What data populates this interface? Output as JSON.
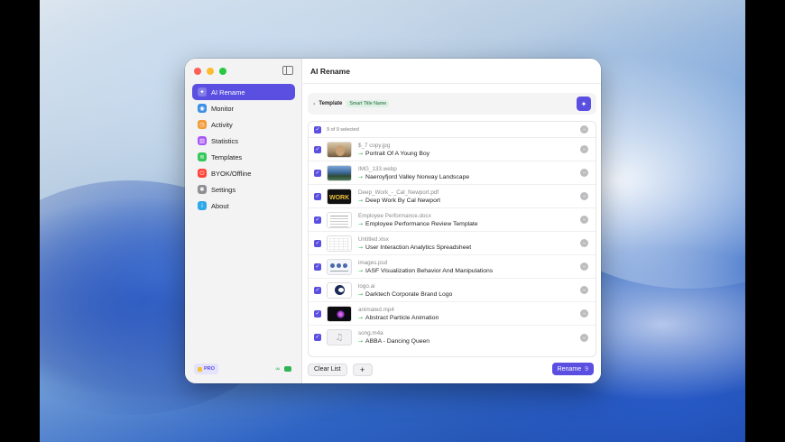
{
  "window": {
    "title": "AI Rename"
  },
  "sidebar": {
    "items": [
      {
        "label": "AI Rename",
        "icon": "sparkle-icon",
        "color": "#ffffff",
        "active": true
      },
      {
        "label": "Monitor",
        "icon": "eye-icon",
        "color": "#3a8ee6"
      },
      {
        "label": "Activity",
        "icon": "activity-icon",
        "color": "#f29b38"
      },
      {
        "label": "Statistics",
        "icon": "chart-icon",
        "color": "#a855f7"
      },
      {
        "label": "Templates",
        "icon": "layers-icon",
        "color": "#34c759"
      },
      {
        "label": "BYOK/Offline",
        "icon": "power-icon",
        "color": "#ff453a"
      },
      {
        "label": "Settings",
        "icon": "gear-icon",
        "color": "#8e8e93"
      },
      {
        "label": "About",
        "icon": "info-icon",
        "color": "#2ea8e6"
      }
    ],
    "badge": "PRO"
  },
  "template": {
    "label": "Template",
    "value": "Smart Title Name"
  },
  "list": {
    "header": "9 of 9 selected",
    "rows": [
      {
        "original": "$_7 copy.jpg",
        "renamed": "Portrait Of A Young Boy",
        "thumb": "portrait"
      },
      {
        "original": "IMG_133.webp",
        "renamed": "Naeroyfjord Valley Norway Landscape",
        "thumb": "norway"
      },
      {
        "original": "Deep_Work_-_Cal_Newport.pdf",
        "renamed": "Deep Work By Cal Newport",
        "thumb": "book"
      },
      {
        "original": "Employee Performance.docx",
        "renamed": "Employee Performance Review Template",
        "thumb": "doc"
      },
      {
        "original": "Untitled.xlsx",
        "renamed": "User Interaction Analytics Spreadsheet",
        "thumb": "sheet"
      },
      {
        "original": "images.psd",
        "renamed": "IASF Visualization Behavior And Manipulations",
        "thumb": "psd"
      },
      {
        "original": "logo.ai",
        "renamed": "Darktech Corporate Brand Logo",
        "thumb": "logo"
      },
      {
        "original": "animated.mp4",
        "renamed": "Abstract Particle Animation",
        "thumb": "anim"
      },
      {
        "original": "song.m4a",
        "renamed": "ABBA - Dancing Queen",
        "thumb": "audio"
      }
    ]
  },
  "footer": {
    "clear_label": "Clear List",
    "add_label": "+",
    "rename_label": "Rename",
    "rename_count": "9"
  },
  "colors": {
    "accent": "#5a4fe0",
    "success": "#2fb456"
  }
}
